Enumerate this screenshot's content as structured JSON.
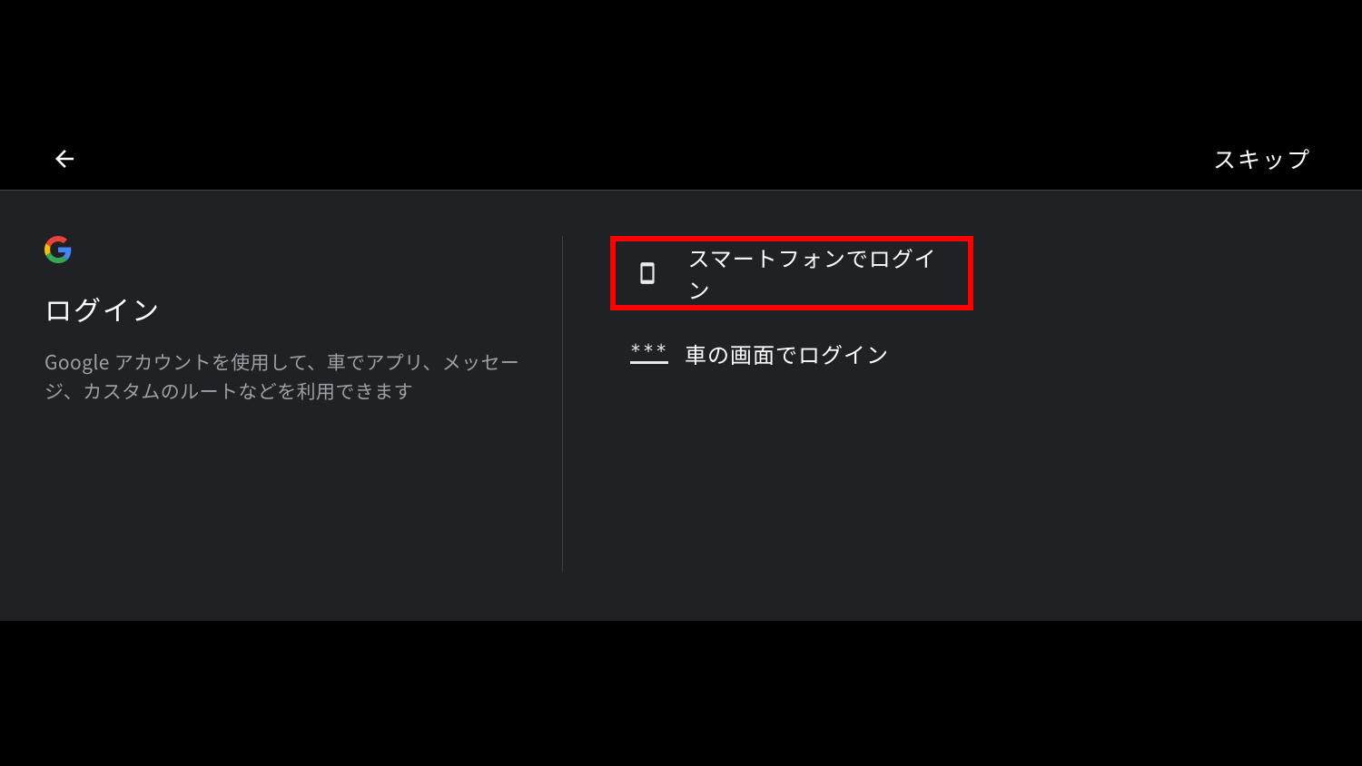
{
  "header": {
    "skip_label": "スキップ"
  },
  "left": {
    "title": "ログイン",
    "description": "Google アカウントを使用して、車でアプリ、メッセージ、カスタムのルートなどを利用できます"
  },
  "options": {
    "smartphone": "スマートフォンでログイン",
    "car_screen": "車の画面でログイン"
  }
}
